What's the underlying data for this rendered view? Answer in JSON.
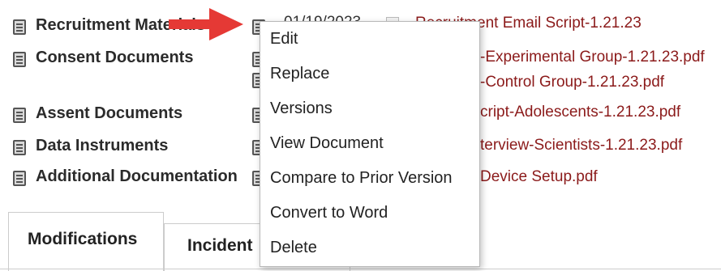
{
  "categories": [
    {
      "label": "Recruitment Materials"
    },
    {
      "label": "Consent Documents"
    },
    {
      "label": "Assent Documents"
    },
    {
      "label": "Data Instruments"
    },
    {
      "label": "Additional Documentation"
    }
  ],
  "files": {
    "row0_date": "01/19/2023",
    "row0": "Recruitment Email Script-1.21.23",
    "row1a": "-Experimental Group-1.21.23.pdf",
    "row1b": "-Control Group-1.21.23.pdf",
    "row2": "cript-Adolescents-1.21.23.pdf",
    "row3": "terview-Scientists-1.21.23.pdf",
    "row4": "Device Setup.pdf"
  },
  "context_menu": {
    "items": [
      "Edit",
      "Replace",
      "Versions",
      "View Document",
      "Compare to Prior Version",
      "Convert to Word",
      "Delete"
    ]
  },
  "tabs": {
    "modifications": "Modifications",
    "incident": "Incident"
  },
  "colors": {
    "link": "#8b1a1a",
    "arrow": "#e53935"
  }
}
